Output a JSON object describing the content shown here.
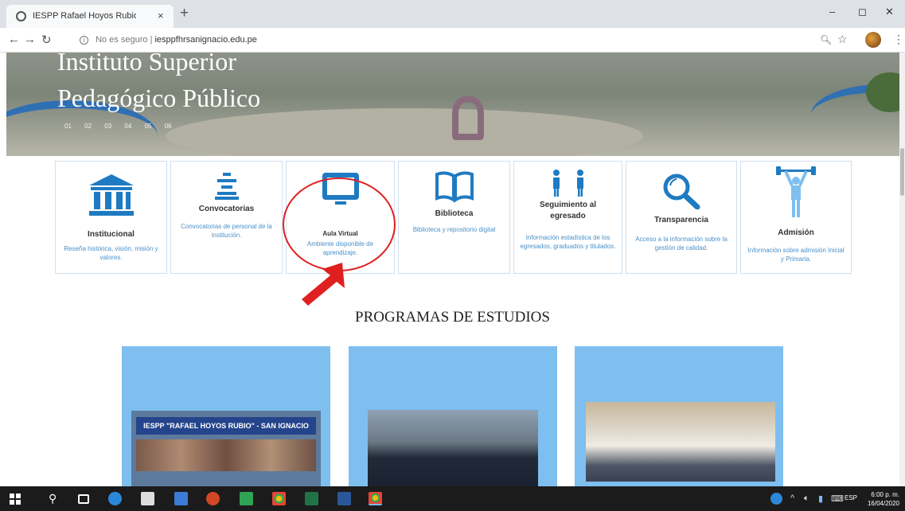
{
  "browser": {
    "tab_title": "IESPP Rafael Hoyos Rubio",
    "tab_close": "×",
    "new_tab": "+",
    "insecure_label": "No es seguro",
    "url": "iesppfhrsanignacio.edu.pe",
    "window_controls": {
      "minimize": "–",
      "maximize": "◻",
      "close": "✕"
    }
  },
  "hero": {
    "title_line1": "Instituto Superior",
    "title_line2": "Pedagógico Público",
    "slide_numbers": [
      "01",
      "02",
      "03",
      "04",
      "05",
      "06"
    ]
  },
  "features": [
    {
      "icon": "building-icon",
      "title": "Institucional",
      "description": "Reseña histórica, visión, misión y valores."
    },
    {
      "icon": "list-lines-icon",
      "title": "Convocatorias",
      "description": "Convocatorias de personal de la institución."
    },
    {
      "icon": "monitor-icon",
      "title": "Aula Virtual",
      "description": "Ambiente disponible de aprendizaje."
    },
    {
      "icon": "book-icon",
      "title": "Biblioteca",
      "description": "Biblioteca y repositorio digital"
    },
    {
      "icon": "people-icon",
      "title": "Seguimiento al egresado",
      "description": "Información estadística de los egresados, graduados y titulados."
    },
    {
      "icon": "magnifier-icon",
      "title": "Transparencia",
      "description": "Acceso a la información sobre la gestión de calidad."
    },
    {
      "icon": "weightlifter-icon",
      "title": "Admisión",
      "description": "Información sobre admisión Inicial y Primaria."
    }
  ],
  "programs": {
    "heading": "PROGRAMAS DE ESTUDIOS",
    "banner_text": "IESPP \"RAFAEL HOYOS RUBIO\" - SAN IGNACIO"
  },
  "taskbar": {
    "language": "ESP",
    "time": "6:00 p. m.",
    "date": "16/04/2020"
  },
  "colors": {
    "accent_blue": "#1f7bc1",
    "card_blue": "#7ebff0",
    "annotation_red": "#e02020"
  }
}
